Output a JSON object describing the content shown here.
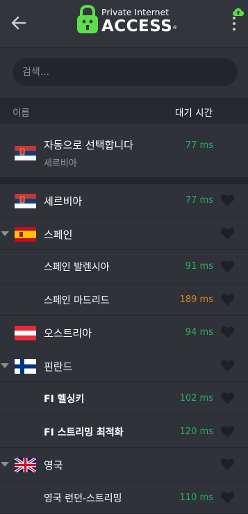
{
  "header": {
    "logo_top": "Private Internet",
    "logo_main": "ACCESS",
    "logo_mark": "®"
  },
  "search": {
    "placeholder": "검색..."
  },
  "columns": {
    "name": "이름",
    "latency": "대기 시간"
  },
  "auto": {
    "title": "자동으로 선택합니다",
    "subtitle": "세르비아",
    "latency": "77 ms"
  },
  "regions": [
    {
      "type": "country",
      "name": "세르비아",
      "flag": "serbia-flag",
      "latency": "77 ms",
      "latency_color": "green"
    },
    {
      "type": "country-group",
      "name": "스페인",
      "flag": "spain-flag",
      "latency": "",
      "expanded": true
    },
    {
      "type": "city",
      "name": "스페인 발렌시아",
      "latency": "91 ms",
      "latency_color": "green"
    },
    {
      "type": "city",
      "name": "스페인 마드리드",
      "latency": "189 ms",
      "latency_color": "orange"
    },
    {
      "type": "country",
      "name": "오스트리아",
      "flag": "austria-flag",
      "latency": "94 ms",
      "latency_color": "green"
    },
    {
      "type": "country-group",
      "name": "핀란드",
      "flag": "finland-flag",
      "latency": "",
      "expanded": true
    },
    {
      "type": "city-bold",
      "name": "FI 헬싱키",
      "latency": "102 ms",
      "latency_color": "green"
    },
    {
      "type": "city-bold",
      "name": "FI 스트리밍 최적화",
      "latency": "120 ms",
      "latency_color": "green"
    },
    {
      "type": "country-group",
      "name": "영국",
      "flag": "uk-flag",
      "latency": "",
      "expanded": true
    },
    {
      "type": "city",
      "name": "영국 런던-스트리밍",
      "latency": "110 ms",
      "latency_color": "green"
    }
  ],
  "colors": {
    "background": "#2f3239",
    "latency_green": "#2bb15a",
    "latency_orange": "#d68a1e",
    "brand_green": "#5ddf4a"
  }
}
